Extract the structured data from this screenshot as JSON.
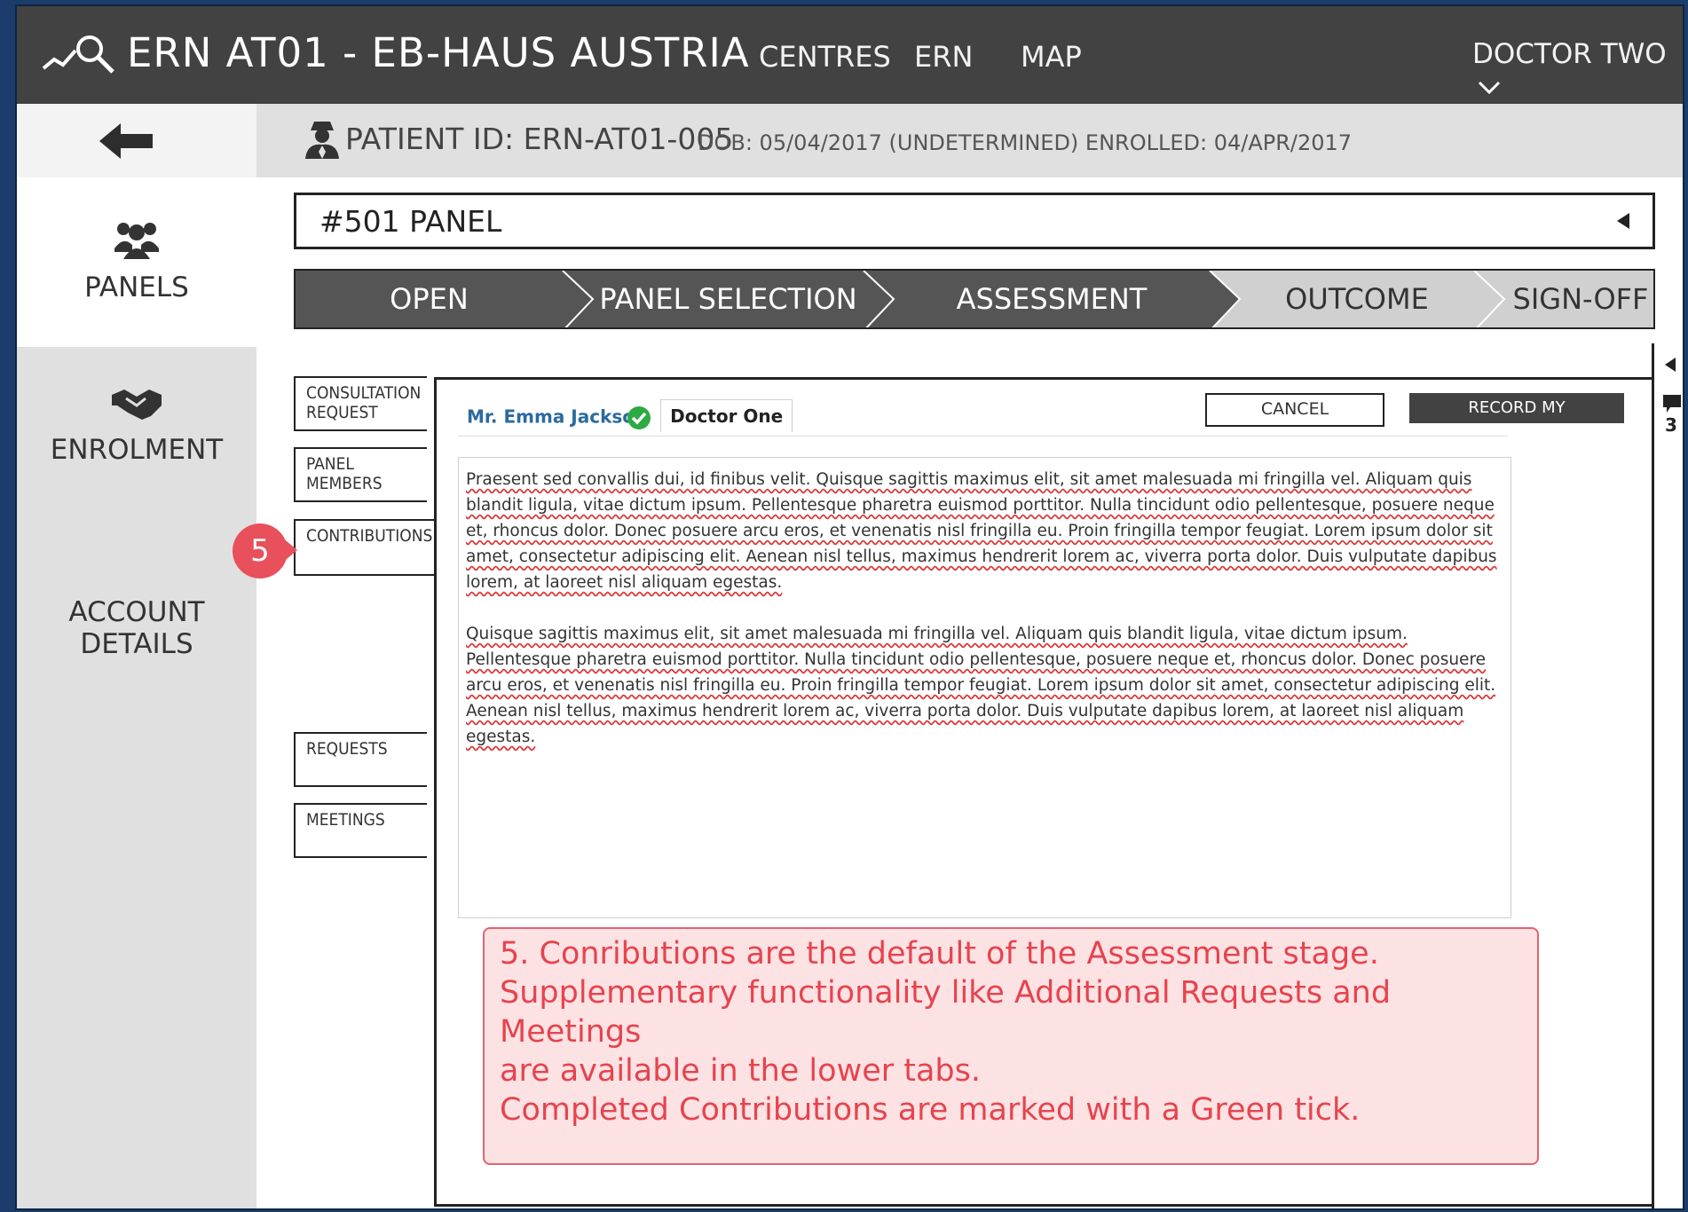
{
  "header": {
    "app_title": "ERN  AT01 - EB-HAUS AUSTRIA",
    "nav": [
      "CENTRES",
      "ERN",
      "MAP"
    ],
    "user": "DOCTOR TWO"
  },
  "sidebar": {
    "items": [
      {
        "label": "PANELS",
        "icon": "people-icon"
      },
      {
        "label": "ENROLMENT",
        "icon": "handshake-icon"
      },
      {
        "label": "ACCOUNT DETAILS",
        "icon": ""
      }
    ]
  },
  "patient": {
    "id_text": "PATIENT ID: ERN-AT01-005",
    "meta_text": "DOB: 05/04/2017 (UNDETERMINED) ENROLLED: 04/APR/2017"
  },
  "panel_select": {
    "value": "#501 PANEL"
  },
  "stepper": {
    "steps": [
      "OPEN",
      "PANEL SELECTION",
      "ASSESSMENT",
      "OUTCOME",
      "SIGN-OFF"
    ],
    "current_index": 2
  },
  "side_tabs": {
    "consultation": [
      "CONSULTATION",
      "REQUEST"
    ],
    "panel_members": [
      "PANEL",
      "MEMBERS"
    ],
    "contributions": "CONTRIBUTIONS",
    "requests": "REQUESTS",
    "meetings": "MEETINGS"
  },
  "content": {
    "tabs": [
      {
        "label": "Mr. Emma Jacksc",
        "completed": true
      },
      {
        "label": "Doctor One",
        "completed": false
      }
    ],
    "cancel_label": "CANCEL",
    "record_label": "RECORD MY CONTRIBUTION",
    "paragraphs": [
      "Praesent sed convallis dui, id finibus velit. Quisque sagittis maximus elit, sit amet malesuada mi fringilla vel. Aliquam quis blandit ligula, vitae dictum ipsum. Pellentesque pharetra euismod porttitor. Nulla tincidunt odio pellentesque, posuere neque et, rhoncus dolor. Donec posuere arcu eros, et venenatis nisl fringilla eu. Proin fringilla tempor feugiat. Lorem ipsum dolor sit amet, consectetur adipiscing elit. Aenean nisl tellus, maximus hendrerit lorem ac, viverra porta dolor. Duis vulputate dapibus lorem, at laoreet nisl aliquam egestas.",
      "Quisque sagittis maximus elit, sit amet malesuada mi fringilla vel. Aliquam quis blandit ligula, vitae dictum ipsum. Pellentesque pharetra euismod porttitor. Nulla tincidunt odio pellentesque, posuere neque et, rhoncus dolor. Donec posuere arcu eros, et venenatis nisl fringilla eu. Proin fringilla tempor feugiat. Lorem ipsum dolor sit amet, consectetur adipiscing elit. Aenean nisl tellus, maximus hendrerit lorem ac, viverra porta dolor. Duis vulputate dapibus lorem, at laoreet nisl aliquam egestas."
    ]
  },
  "right_strip": {
    "comment_count": "3"
  },
  "annotation": {
    "badge": "5",
    "lines": [
      "5. Conributions are the default of the Assessment stage.",
      "Supplementary functionality like Additional Requests and Meetings",
      "are available in the lower tabs.",
      "Completed Contributions are marked with a Green tick."
    ]
  },
  "colors": {
    "header_bg": "#424242",
    "sidebar_bg": "#e0e0e0",
    "accent_red": "#e8505b",
    "tick_green": "#2eaa45",
    "link_blue": "#2b6aa0"
  }
}
